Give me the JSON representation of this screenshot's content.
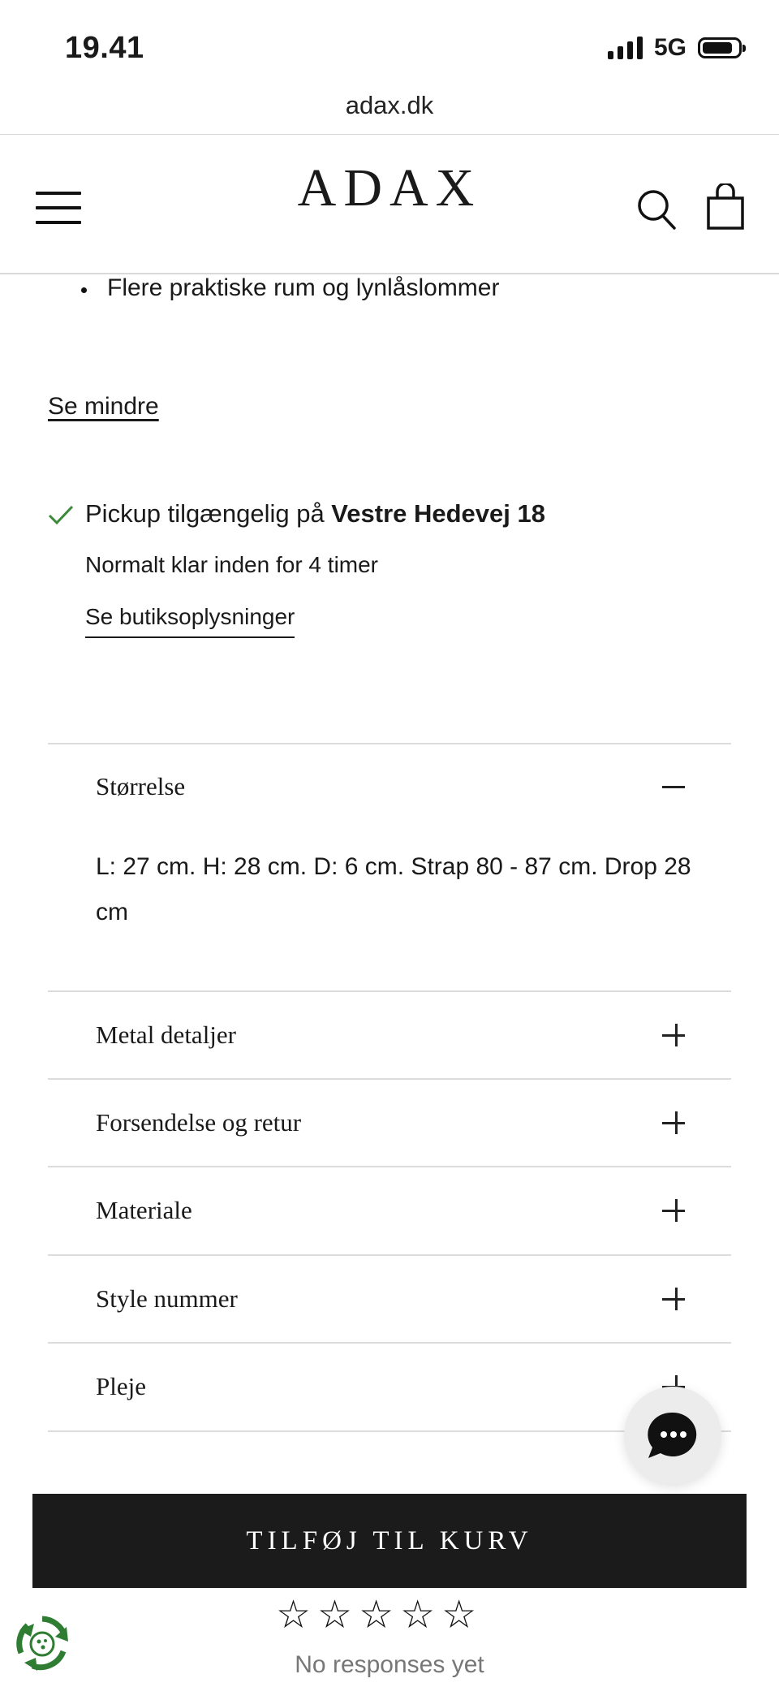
{
  "status_bar": {
    "time": "19.41",
    "network": "5G",
    "battery_level": 0.85
  },
  "browser": {
    "url": "adax.dk"
  },
  "header": {
    "logo": "ADAX",
    "icons": [
      "menu-icon",
      "search-icon",
      "shopping-bag-icon"
    ]
  },
  "description": {
    "bullet": "Flere praktiske rum og lynlåslommer",
    "toggle_label": "Se mindre"
  },
  "pickup": {
    "prefix": "Pickup tilgængelig på ",
    "store": "Vestre Hedevej 18",
    "eta": "Normalt klar inden for 4 timer",
    "link": "Se butiksoplysninger",
    "status_color": "#3a8a3a"
  },
  "accordion": {
    "size": {
      "title": "Størrelse",
      "content": "L: 27 cm. H: 28 cm. D: 6 cm. Strap 80 - 87 cm. Drop 28 cm",
      "expanded": true
    },
    "items": [
      {
        "title": "Metal detaljer",
        "expanded": false
      },
      {
        "title": "Forsendelse og retur",
        "expanded": false
      },
      {
        "title": "Materiale",
        "expanded": false
      },
      {
        "title": "Style nummer",
        "expanded": false
      },
      {
        "title": "Pleje",
        "expanded": false
      }
    ]
  },
  "cta": {
    "add_to_cart": "TILFØJ TIL KURV"
  },
  "reviews": {
    "rating": 0,
    "max_rating": 5,
    "empty_text": "No responses yet"
  },
  "colors": {
    "button_bg": "#1b1b1b",
    "button_text": "#ffffff",
    "divider": "#dcdcdc",
    "check": "#3a8a3a",
    "badge": "#2e7d32"
  }
}
